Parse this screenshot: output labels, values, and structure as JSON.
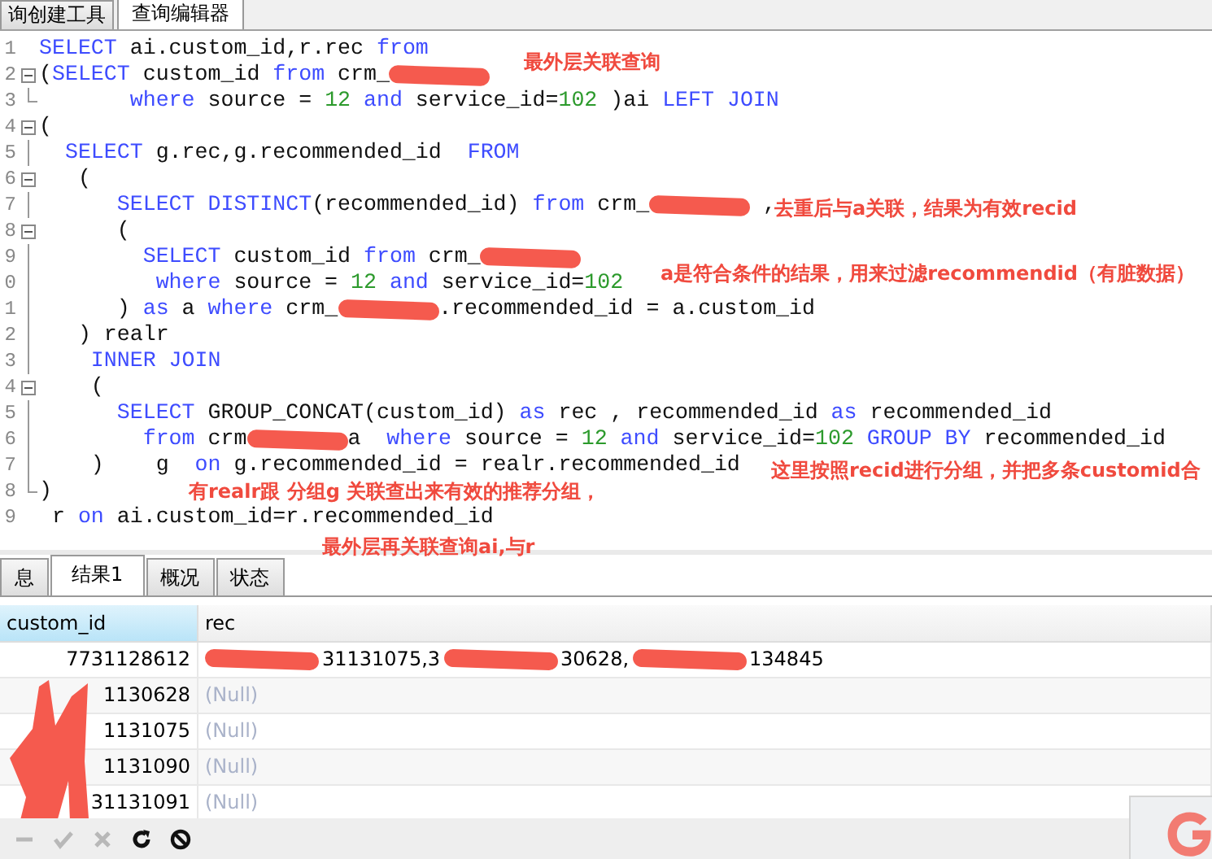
{
  "top_tabs": [
    {
      "label": "询创建工具",
      "selected": false
    },
    {
      "label": "查询编辑器",
      "selected": true
    }
  ],
  "editor": {
    "lines": [
      {
        "number": "1",
        "kind": "plain",
        "tokens": [
          {
            "kind": "kw",
            "text": "SELECT"
          },
          {
            "kind": "code",
            "text": " ai.custom_id,r.rec "
          },
          {
            "kind": "kw",
            "text": "from"
          }
        ]
      },
      {
        "number": "2",
        "kind": "fold_open",
        "tokens": [
          {
            "kind": "code",
            "text": "("
          },
          {
            "kind": "kw",
            "text": "SELECT"
          },
          {
            "kind": "code",
            "text": " custom_id "
          },
          {
            "kind": "kw",
            "text": "from"
          },
          {
            "kind": "code",
            "text": " crm_"
          },
          {
            "kind": "redact"
          }
        ]
      },
      {
        "number": "3",
        "kind": "fold_end",
        "tokens": [
          {
            "kind": "kw",
            "text": "       where"
          },
          {
            "kind": "code",
            "text": " source = "
          },
          {
            "kind": "num",
            "text": "12"
          },
          {
            "kind": "kw",
            "text": " and"
          },
          {
            "kind": "code",
            "text": " service_id="
          },
          {
            "kind": "num",
            "text": "102"
          },
          {
            "kind": "code",
            "text": " )ai "
          },
          {
            "kind": "kw",
            "text": "LEFT JOIN"
          }
        ]
      },
      {
        "number": "4",
        "kind": "fold_open",
        "tokens": [
          {
            "kind": "code",
            "text": "("
          }
        ]
      },
      {
        "number": "5",
        "kind": "fold_line",
        "tokens": [
          {
            "kind": "kw",
            "text": "  SELECT"
          },
          {
            "kind": "code",
            "text": " g.rec,g.recommended_id  "
          },
          {
            "kind": "kw",
            "text": "FROM"
          }
        ]
      },
      {
        "number": "6",
        "kind": "fold_open",
        "tokens": [
          {
            "kind": "code",
            "text": "   ("
          }
        ]
      },
      {
        "number": "7",
        "kind": "fold_line",
        "tokens": [
          {
            "kind": "kw",
            "text": "      SELECT DISTINCT"
          },
          {
            "kind": "code",
            "text": "(recommended_id) "
          },
          {
            "kind": "kw",
            "text": "from"
          },
          {
            "kind": "code",
            "text": " crm_"
          },
          {
            "kind": "redact"
          },
          {
            "kind": "code",
            "text": " ,"
          }
        ]
      },
      {
        "number": "8",
        "kind": "fold_open",
        "tokens": [
          {
            "kind": "code",
            "text": "      ("
          }
        ]
      },
      {
        "number": "9",
        "kind": "fold_line",
        "tokens": [
          {
            "kind": "kw",
            "text": "        SELECT"
          },
          {
            "kind": "code",
            "text": " custom_id "
          },
          {
            "kind": "kw",
            "text": "from"
          },
          {
            "kind": "code",
            "text": " crm_"
          },
          {
            "kind": "redact"
          }
        ]
      },
      {
        "number": "0",
        "kind": "fold_line",
        "tokens": [
          {
            "kind": "kw",
            "text": "         where"
          },
          {
            "kind": "code",
            "text": " source = "
          },
          {
            "kind": "num",
            "text": "12"
          },
          {
            "kind": "kw",
            "text": " and"
          },
          {
            "kind": "code",
            "text": " service_id="
          },
          {
            "kind": "num",
            "text": "102"
          }
        ]
      },
      {
        "number": "1",
        "kind": "fold_line",
        "tokens": [
          {
            "kind": "code",
            "text": "      ) "
          },
          {
            "kind": "kw",
            "text": "as"
          },
          {
            "kind": "code",
            "text": " a "
          },
          {
            "kind": "kw",
            "text": "where"
          },
          {
            "kind": "code",
            "text": " crm_"
          },
          {
            "kind": "redact"
          },
          {
            "kind": "code",
            "text": ".recommended_id = a.custom_id"
          }
        ]
      },
      {
        "number": "2",
        "kind": "fold_line",
        "tokens": [
          {
            "kind": "code",
            "text": "   ) realr"
          }
        ]
      },
      {
        "number": "3",
        "kind": "fold_line",
        "tokens": [
          {
            "kind": "kw",
            "text": "    INNER JOIN"
          }
        ]
      },
      {
        "number": "4",
        "kind": "fold_open",
        "tokens": [
          {
            "kind": "code",
            "text": "    ("
          }
        ]
      },
      {
        "number": "5",
        "kind": "fold_line",
        "tokens": [
          {
            "kind": "kw",
            "text": "      SELECT"
          },
          {
            "kind": "code",
            "text": " GROUP_CONCAT(custom_id) "
          },
          {
            "kind": "kw",
            "text": "as"
          },
          {
            "kind": "code",
            "text": " rec , recommended_id "
          },
          {
            "kind": "kw",
            "text": "as"
          },
          {
            "kind": "code",
            "text": " recommended_id"
          }
        ]
      },
      {
        "number": "6",
        "kind": "fold_line",
        "tokens": [
          {
            "kind": "kw",
            "text": "        from"
          },
          {
            "kind": "code",
            "text": " crm"
          },
          {
            "kind": "redact"
          },
          {
            "kind": "code",
            "text": "a  "
          },
          {
            "kind": "kw",
            "text": "where"
          },
          {
            "kind": "code",
            "text": " source = "
          },
          {
            "kind": "num",
            "text": "12"
          },
          {
            "kind": "kw",
            "text": " and"
          },
          {
            "kind": "code",
            "text": " service_id="
          },
          {
            "kind": "num",
            "text": "102"
          },
          {
            "kind": "kw",
            "text": " GROUP BY"
          },
          {
            "kind": "code",
            "text": " recommended_id"
          }
        ]
      },
      {
        "number": "7",
        "kind": "fold_line",
        "tokens": [
          {
            "kind": "code",
            "text": "    )    g  "
          },
          {
            "kind": "kw",
            "text": "on"
          },
          {
            "kind": "code",
            "text": " g.recommended_id = realr.recommended_id"
          }
        ]
      },
      {
        "number": "8",
        "kind": "fold_end",
        "tokens": [
          {
            "kind": "code",
            "text": ")"
          }
        ]
      },
      {
        "number": "9",
        "kind": "plain",
        "tokens": [
          {
            "kind": "code",
            "text": " r "
          },
          {
            "kind": "kw",
            "text": "on"
          },
          {
            "kind": "code",
            "text": " ai.custom_id=r.recommended_id"
          }
        ]
      }
    ]
  },
  "annotations": [
    "最外层关联查询",
    "去重后与a关联，结果为有效recid",
    "a是符合条件的结果，用来过滤recommendid（有脏数据）",
    "这里按照recid进行分组，并把多条customid合",
    "有realr跟 分组g 关联查出来有效的推荐分组，",
    "最外层再关联查询ai,与r"
  ],
  "result_tabs": [
    {
      "label": "息",
      "selected": false
    },
    {
      "label": "结果1",
      "selected": true
    },
    {
      "label": "概况",
      "selected": false
    },
    {
      "label": "状态",
      "selected": false
    }
  ],
  "grid": {
    "columns": [
      {
        "label": "custom_id",
        "selected": true
      },
      {
        "label": "rec",
        "selected": false
      }
    ],
    "rows": [
      {
        "custom_id": "7731128612",
        "rec": {
          "kind": "value",
          "parts": [
            {
              "kind": "redact"
            },
            {
              "kind": "code",
              "text": "31131075,3"
            },
            {
              "kind": "redact"
            },
            {
              "kind": "code",
              "text": "30628,"
            },
            {
              "kind": "redact"
            },
            {
              "kind": "code",
              "text": "134845"
            }
          ]
        }
      },
      {
        "custom_id": "1130628",
        "rec": {
          "kind": "null",
          "parts": [
            {
              "kind": "code",
              "text": "(Null)"
            }
          ]
        }
      },
      {
        "custom_id": "1131075",
        "rec": {
          "kind": "null",
          "parts": [
            {
              "kind": "code",
              "text": "(Null)"
            }
          ]
        }
      },
      {
        "custom_id": "1131090",
        "rec": {
          "kind": "null",
          "parts": [
            {
              "kind": "code",
              "text": "(Null)"
            }
          ]
        }
      },
      {
        "custom_id": "31131091",
        "rec": {
          "kind": "null",
          "parts": [
            {
              "kind": "code",
              "text": "(Null)"
            }
          ]
        }
      }
    ]
  },
  "toolbar": [
    {
      "kind": "minus",
      "disabled": true
    },
    {
      "kind": "check",
      "disabled": true
    },
    {
      "kind": "cross",
      "disabled": true
    },
    {
      "kind": "refresh",
      "disabled": false
    },
    {
      "kind": "stop",
      "disabled": false
    }
  ]
}
